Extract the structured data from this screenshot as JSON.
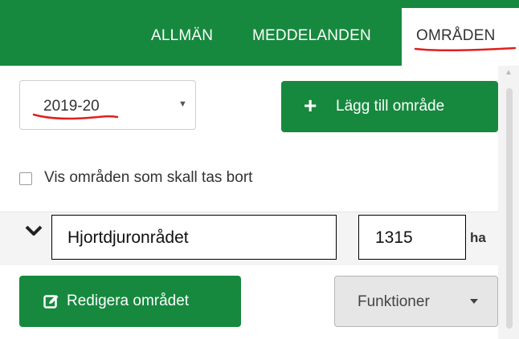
{
  "nav": {
    "tabs": [
      "ALLMÄN",
      "MEDDELANDEN",
      "OMRÅDEN"
    ],
    "active_tab": "OMRÅDEN"
  },
  "season": {
    "selected": "2019-20"
  },
  "toolbar": {
    "add_area_label": "Lägg till område"
  },
  "filters": {
    "show_removed_label": "Vis områden som skall tas bort",
    "show_removed_checked": false
  },
  "area": {
    "name": "Hjortdjuronrådet",
    "size": "1315",
    "unit": "ha"
  },
  "actions": {
    "edit_label": "Redigera området",
    "functions_label": "Funktioner"
  },
  "colors": {
    "brand_green": "#16893e",
    "annotation_red": "#e0201c"
  },
  "icons": [
    "plus-icon",
    "chevron-down-icon",
    "edit-icon",
    "caret-down-icon"
  ]
}
